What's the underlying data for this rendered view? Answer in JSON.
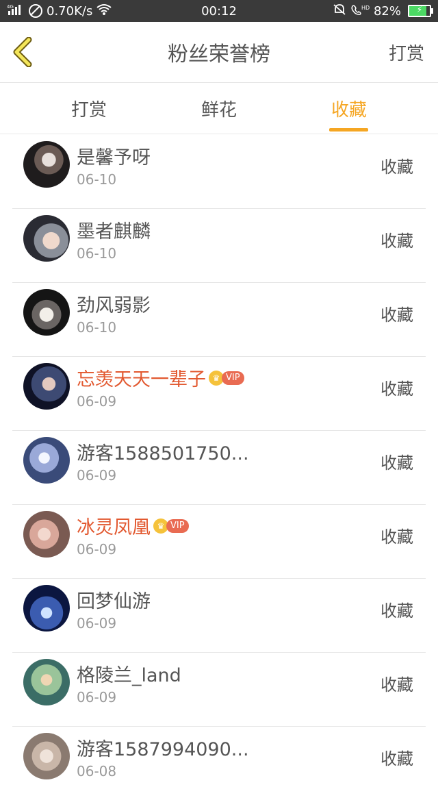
{
  "status_bar": {
    "network": "4G",
    "speed": "0.70K/s",
    "time": "00:12",
    "battery": "82%",
    "battery_level": 0.82,
    "icons": [
      "signal-icon",
      "wifi-icon",
      "mute-icon",
      "hd-call-icon",
      "battery-icon"
    ]
  },
  "header": {
    "title": "粉丝荣誉榜",
    "action": "打赏",
    "back_icon": "chevron-left-icon"
  },
  "tabs": [
    {
      "label": "打赏"
    },
    {
      "label": "鲜花"
    },
    {
      "label": "收藏",
      "active": true
    }
  ],
  "colors": {
    "accent": "#f5a623",
    "vip_name": "#e2582f",
    "text": "#555555",
    "date": "#999999"
  },
  "list": [
    {
      "name": "是馨予呀",
      "date": "06-10",
      "action": "收藏",
      "vip": false
    },
    {
      "name": "墨者麒麟",
      "date": "06-10",
      "action": "收藏",
      "vip": false
    },
    {
      "name": "劲风弱影",
      "date": "06-10",
      "action": "收藏",
      "vip": false
    },
    {
      "name": "忘羡天天一辈子",
      "date": "06-09",
      "action": "收藏",
      "vip": true,
      "badge": "VIP"
    },
    {
      "name": "游客1588501750...",
      "date": "06-09",
      "action": "收藏",
      "vip": false
    },
    {
      "name": "冰灵凤凰",
      "date": "06-09",
      "action": "收藏",
      "vip": true,
      "badge": "VIP"
    },
    {
      "name": "回梦仙游",
      "date": "06-09",
      "action": "收藏",
      "vip": false
    },
    {
      "name": "格陵兰_land",
      "date": "06-09",
      "action": "收藏",
      "vip": false
    },
    {
      "name": "游客1587994090...",
      "date": "06-08",
      "action": "收藏",
      "vip": false
    }
  ]
}
